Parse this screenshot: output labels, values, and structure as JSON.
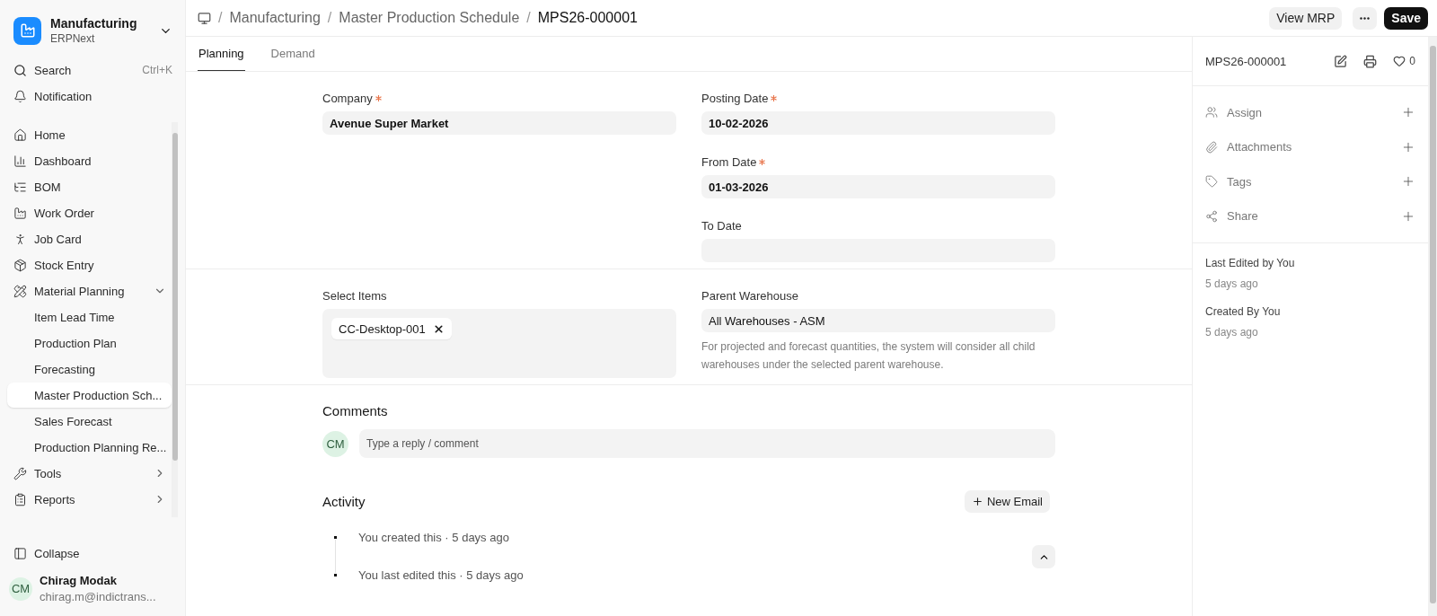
{
  "app": {
    "name": "Manufacturing",
    "subtitle": "ERPNext"
  },
  "sidebar": {
    "search": {
      "label": "Search",
      "shortcut": "Ctrl+K"
    },
    "notification": "Notification",
    "items": [
      {
        "label": "Home",
        "selected": false
      },
      {
        "label": "Dashboard",
        "selected": false
      },
      {
        "label": "BOM",
        "selected": false
      },
      {
        "label": "Work Order",
        "selected": false
      },
      {
        "label": "Job Card",
        "selected": false
      },
      {
        "label": "Stock Entry",
        "selected": false
      },
      {
        "label": "Material Planning",
        "selected": false,
        "expanded": true,
        "children": [
          {
            "label": "Item Lead Time",
            "selected": false
          },
          {
            "label": "Production Plan",
            "selected": false
          },
          {
            "label": "Forecasting",
            "selected": false
          },
          {
            "label": "Master Production Sch...",
            "selected": true
          },
          {
            "label": "Sales Forecast",
            "selected": false
          },
          {
            "label": "Production Planning Re...",
            "selected": false
          }
        ]
      },
      {
        "label": "Tools",
        "selected": false,
        "expanded": false
      },
      {
        "label": "Reports",
        "selected": false,
        "expanded": false
      }
    ],
    "collapse": "Collapse",
    "user": {
      "initials": "CM",
      "name": "Chirag Modak",
      "email": "chirag.m@indictrans..."
    }
  },
  "breadcrumbs": [
    "Manufacturing",
    "Master Production Schedule",
    "MPS26-000001"
  ],
  "breadcrumb_separator": "/",
  "actions": {
    "view_mrp": "View MRP",
    "save": "Save"
  },
  "tabs": [
    {
      "label": "Planning",
      "selected": true
    },
    {
      "label": "Demand",
      "selected": false
    }
  ],
  "form": {
    "company": {
      "label": "Company",
      "required": true,
      "value": "Avenue Super Market"
    },
    "dates": [
      {
        "label": "Posting Date",
        "required": true,
        "value": "10-02-2026"
      },
      {
        "label": "From Date",
        "required": true,
        "value": "01-03-2026"
      },
      {
        "label": "To Date",
        "required": false
      }
    ],
    "select_items": {
      "label": "Select Items",
      "tags": [
        "CC-Desktop-001"
      ]
    },
    "parent_warehouse": {
      "label": "Parent Warehouse",
      "value": "All Warehouses - ASM",
      "description": "For projected and forecast quantities, the system will consider all child warehouses under the selected parent warehouse."
    }
  },
  "comments": {
    "title": "Comments",
    "avatar": "CM",
    "placeholder": "Type a reply / comment"
  },
  "activity": {
    "title": "Activity",
    "new_email": "New Email",
    "items": [
      "You created this · 5 days ago",
      "You last edited this · 5 days ago"
    ]
  },
  "side_panel": {
    "title": "MPS26-000001",
    "likes": "0",
    "actions": [
      "Assign",
      "Attachments",
      "Tags",
      "Share"
    ],
    "meta": [
      {
        "label": "Last Edited by You",
        "value": "5 days ago"
      },
      {
        "label": "Created By You",
        "value": "5 days ago"
      }
    ]
  }
}
